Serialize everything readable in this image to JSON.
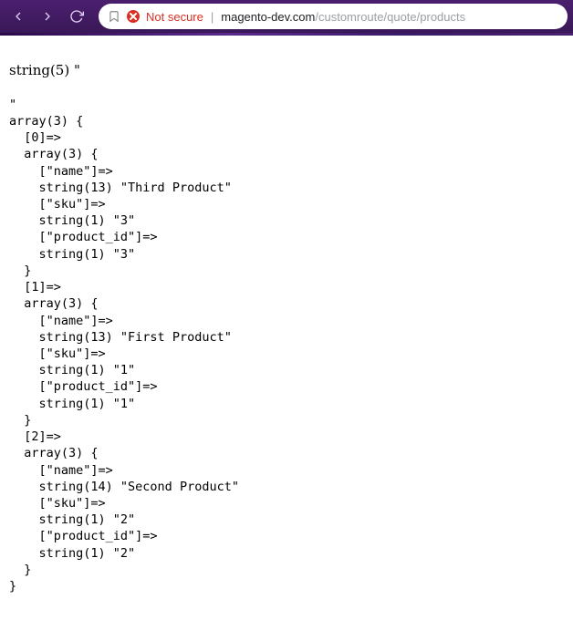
{
  "address": {
    "security_label": "Not secure",
    "domain": "magento-dev.com",
    "path": "/customroute/quote/products"
  },
  "page": {
    "top_line": "string(5) \"",
    "dump": "\"\narray(3) {\n  [0]=>\n  array(3) {\n    [\"name\"]=>\n    string(13) \"Third Product\"\n    [\"sku\"]=>\n    string(1) \"3\"\n    [\"product_id\"]=>\n    string(1) \"3\"\n  }\n  [1]=>\n  array(3) {\n    [\"name\"]=>\n    string(13) \"First Product\"\n    [\"sku\"]=>\n    string(1) \"1\"\n    [\"product_id\"]=>\n    string(1) \"1\"\n  }\n  [2]=>\n  array(3) {\n    [\"name\"]=>\n    string(14) \"Second Product\"\n    [\"sku\"]=>\n    string(1) \"2\"\n    [\"product_id\"]=>\n    string(1) \"2\"\n  }\n}"
  }
}
